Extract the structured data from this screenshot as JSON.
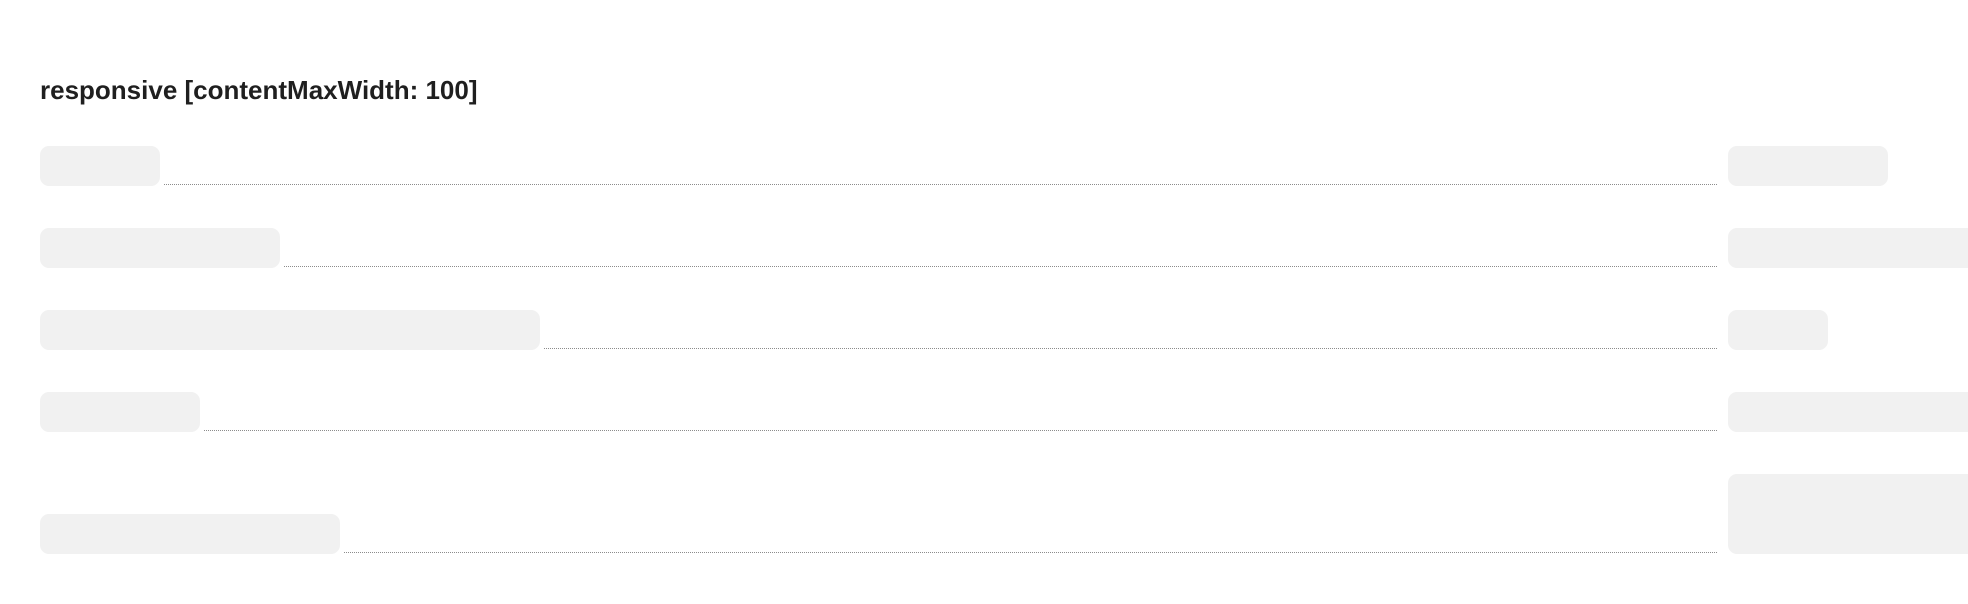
{
  "page": {
    "title": "responsive [contentMaxWidth: 100]"
  },
  "colors": {
    "background": "#ffffff",
    "title_text": "#1f1f1f",
    "skeleton_fill": "#f1f1f1",
    "leader_dots": "#8c8c8c"
  },
  "list": {
    "rows": [
      {
        "row": 1
      },
      {
        "row": 2
      },
      {
        "row": 3
      },
      {
        "row": 4
      },
      {
        "row": 5
      }
    ]
  }
}
